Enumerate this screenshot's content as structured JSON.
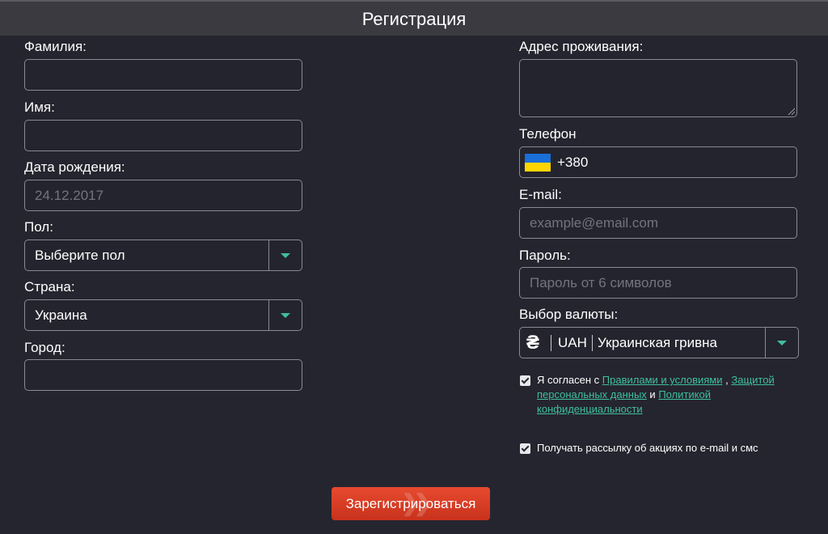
{
  "header": {
    "title": "Регистрация"
  },
  "left": {
    "surname": {
      "label": "Фамилия:",
      "value": ""
    },
    "name": {
      "label": "Имя:",
      "value": ""
    },
    "birthdate": {
      "label": "Дата рождения:",
      "placeholder": "24.12.2017"
    },
    "gender": {
      "label": "Пол:",
      "selected": "Выберите пол"
    },
    "country": {
      "label": "Страна:",
      "selected": "Украина"
    },
    "city": {
      "label": "Город:",
      "value": ""
    }
  },
  "right": {
    "address": {
      "label": "Адрес проживания:",
      "value": ""
    },
    "phone": {
      "label": "Телефон",
      "code": "+380",
      "flag": "ukraine-flag-icon"
    },
    "email": {
      "label": "E-mail:",
      "placeholder": "example@email.com"
    },
    "password": {
      "label": "Пароль:",
      "placeholder": "Пароль от 6 символов"
    },
    "currency": {
      "label": "Выбор валюты:",
      "symbol": "₴",
      "code": "UAH",
      "name": "Украинская гривна"
    }
  },
  "consent": {
    "checked": true,
    "prefix": "Я согласен с",
    "terms_link": "Правилами и условиями",
    "sep": ",",
    "privacy_link_1": "Защитой персональных данных",
    "and": "и",
    "privacy_link_2": "Политикой конфиденциальности"
  },
  "newsletter": {
    "checked": true,
    "label": "Получать рассылку об акциях по e-mail и смс"
  },
  "submit": {
    "label": "Зарегистрироваться"
  },
  "colors": {
    "accent": "#3fbf9f",
    "button": "#d93c24",
    "background": "#24242e"
  }
}
